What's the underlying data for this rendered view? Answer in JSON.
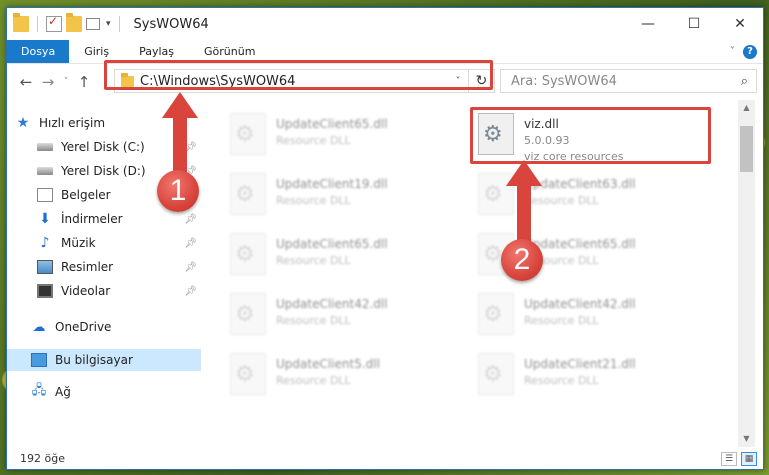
{
  "window": {
    "title": "SysWOW64",
    "controls": {
      "minimize": "—",
      "maximize": "☐",
      "close": "✕"
    }
  },
  "ribbon": {
    "tabs": [
      "Dosya",
      "Giriş",
      "Paylaş",
      "Görünüm"
    ],
    "help": "?"
  },
  "nav": {
    "back": "←",
    "forward": "→",
    "history": "˅",
    "up": "↑",
    "address": "C:\\Windows\\SysWOW64",
    "refresh": "↻",
    "search_placeholder": "Ara: SysWOW64"
  },
  "sidebar": {
    "quick_access": "Hızlı erişim",
    "items": [
      {
        "label": "Yerel Disk (C:)",
        "icon": "drive-icon",
        "pinned": true
      },
      {
        "label": "Yerel Disk (D:)",
        "icon": "drive-icon",
        "pinned": true
      },
      {
        "label": "Belgeler",
        "icon": "documents-icon",
        "pinned": true
      },
      {
        "label": "İndirmeler",
        "icon": "download-icon",
        "pinned": true
      },
      {
        "label": "Müzik",
        "icon": "music-icon",
        "pinned": true
      },
      {
        "label": "Resimler",
        "icon": "pictures-icon",
        "pinned": true
      },
      {
        "label": "Videolar",
        "icon": "videos-icon",
        "pinned": true
      }
    ],
    "onedrive": "OneDrive",
    "this_pc": "Bu bilgisayar",
    "network": "Ağ"
  },
  "files": [
    {
      "name": "UpdateClient65.dll",
      "desc": "Resource DLL"
    },
    {
      "name": "viz.dll",
      "version": "5.0.0.93",
      "desc": "viz core resources"
    },
    {
      "name": "UpdateClient19.dll",
      "desc": "Resource DLL"
    },
    {
      "name": "UpdateClient63.dll",
      "desc": "Resource DLL"
    },
    {
      "name": "UpdateClient65.dll",
      "desc": "Resource DLL"
    },
    {
      "name": "UpdateClient65.dll",
      "desc": "Resource DLL"
    },
    {
      "name": "UpdateClient42.dll",
      "desc": "Resource DLL"
    },
    {
      "name": "UpdateClient42.dll",
      "desc": "Resource DLL"
    },
    {
      "name": "UpdateClient5.dll",
      "desc": "Resource DLL"
    },
    {
      "name": "UpdateClient21.dll",
      "desc": "Resource DLL"
    }
  ],
  "status": {
    "count": "192 öğe"
  },
  "annotations": {
    "step1": "1",
    "step2": "2",
    "color": "#d9443c"
  }
}
